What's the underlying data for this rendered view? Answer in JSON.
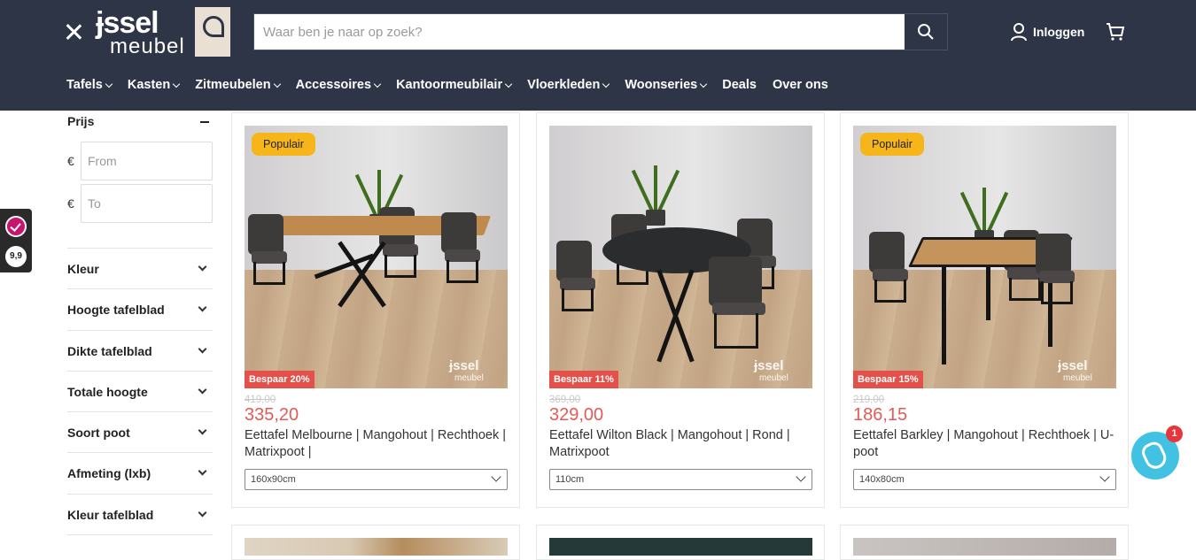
{
  "header": {
    "logo_top": "ɉssel",
    "logo_bottom": "meubel",
    "search_placeholder": "Waar ben je naar op zoek?",
    "login_label": "Inloggen",
    "colors": {
      "header_bg": "#2e3547",
      "popular_badge": "#f6b519",
      "sale_badge": "#e3514a",
      "sale_price": "#e55a54",
      "chat": "#42c2e3"
    }
  },
  "nav": [
    {
      "label": "Tafels",
      "dropdown": true
    },
    {
      "label": "Kasten",
      "dropdown": true
    },
    {
      "label": "Zitmeubelen",
      "dropdown": true
    },
    {
      "label": "Accessoires",
      "dropdown": true
    },
    {
      "label": "Kantoormeubilair",
      "dropdown": true
    },
    {
      "label": "Vloerkleden",
      "dropdown": true
    },
    {
      "label": "Woonseries",
      "dropdown": true
    },
    {
      "label": "Deals",
      "dropdown": false
    },
    {
      "label": "Over ons",
      "dropdown": false
    }
  ],
  "sidebar": {
    "price_title": "Prijs",
    "currency": "€",
    "from_placeholder": "From",
    "to_placeholder": "To",
    "filters": [
      "Kleur",
      "Hoogte tafelblad",
      "Dikte tafelblad",
      "Totale hoogte",
      "Soort poot",
      "Afmeting (lxb)",
      "Kleur tafelblad"
    ]
  },
  "rating_widget": {
    "score": "9,9"
  },
  "products": [
    {
      "badge": "Populair",
      "discount": "Bespaar 20%",
      "old_price": "419,00",
      "price": "335,20",
      "title": "Eettafel Melbourne | Mangohout | Rechthoek | Matrixpoot |",
      "variant": "160x90cm"
    },
    {
      "badge": "",
      "discount": "Bespaar 11%",
      "old_price": "369,00",
      "price": "329,00",
      "title": "Eettafel Wilton Black | Mangohout | Rond | Matrixpoot",
      "variant": "110cm"
    },
    {
      "badge": "Populair",
      "discount": "Bespaar 15%",
      "old_price": "219,00",
      "price": "186,15",
      "title": "Eettafel Barkley | Mangohout | Rechthoek | U-poot",
      "variant": "140x80cm"
    }
  ],
  "watermark": {
    "top": "ɉssel",
    "bottom": "meubel"
  },
  "chat": {
    "count": "1",
    "icon": "waving-hand-icon"
  }
}
